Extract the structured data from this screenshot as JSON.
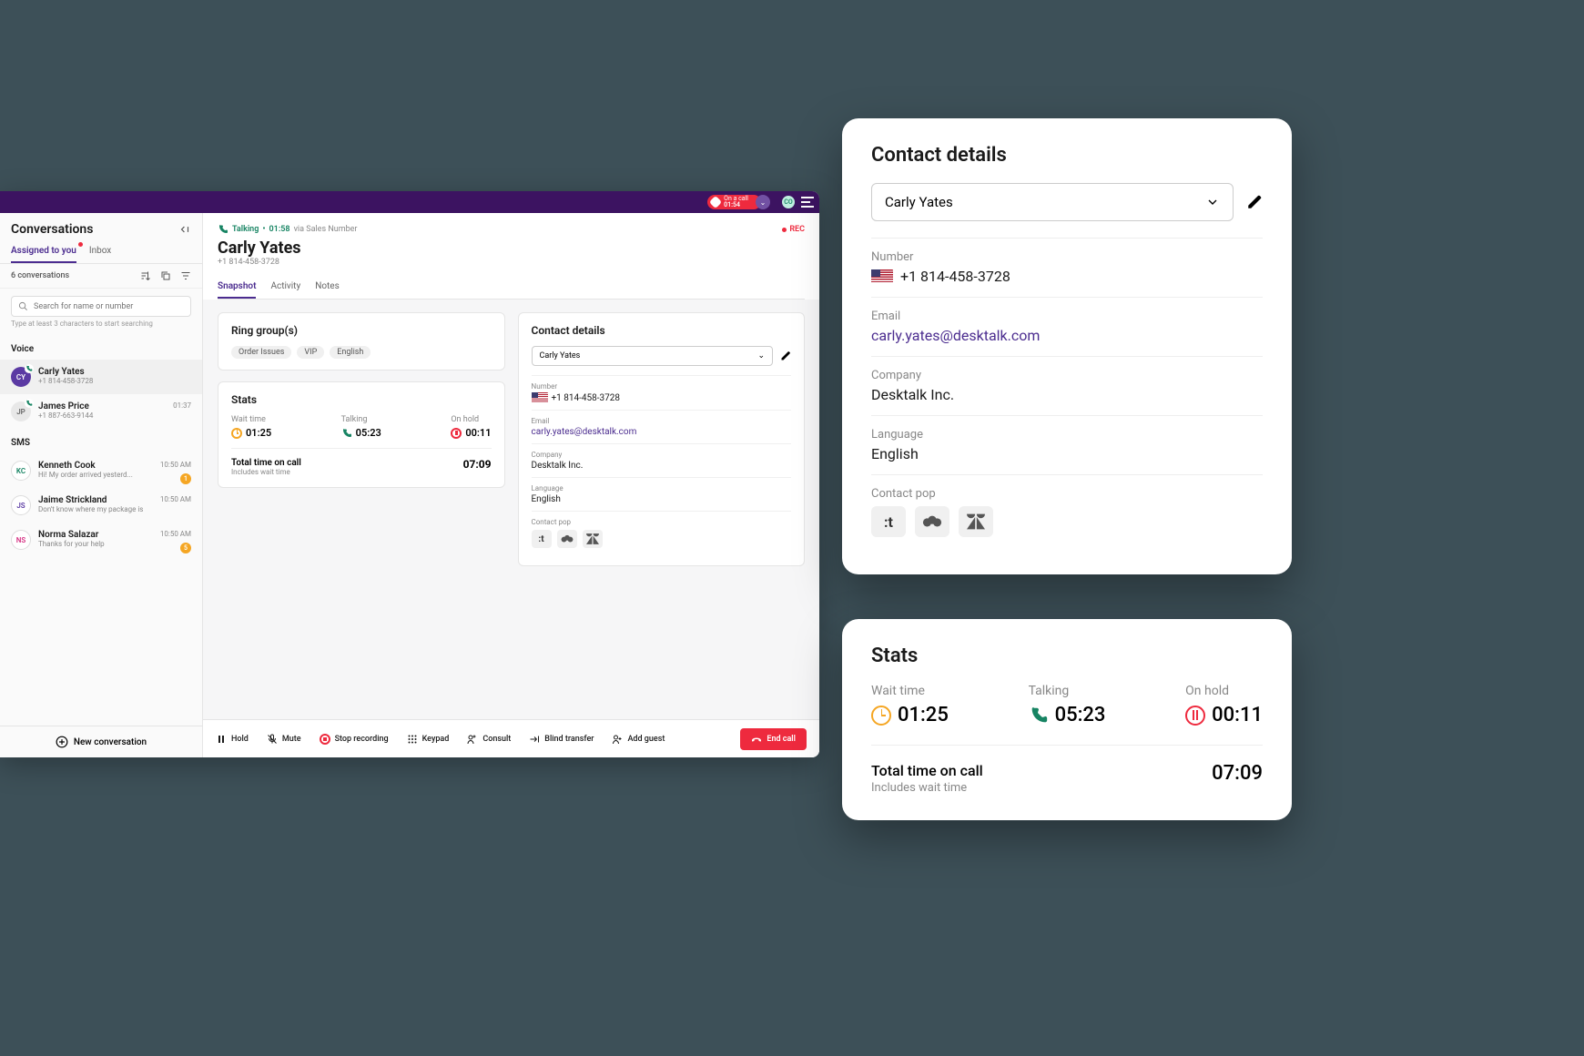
{
  "topbar": {
    "call_status": "On a call",
    "call_time": "01:54",
    "avatar": "CO"
  },
  "sidebar": {
    "title": "Conversations",
    "tabs": [
      "Assigned to you",
      "Inbox"
    ],
    "count": "6 conversations",
    "search_placeholder": "Search for name or number",
    "hint": "Type at least 3 characters to start searching",
    "voice_label": "Voice",
    "sms_label": "SMS",
    "voice": [
      {
        "initials": "CY",
        "name": "Carly Yates",
        "sub": "+1 814-458-3728",
        "time": "",
        "avbg": "#5b3aa3",
        "avfg": "#fff",
        "selected": true,
        "phone": true
      },
      {
        "initials": "JP",
        "name": "James Price",
        "sub": "+1 887-663-9144",
        "time": "01:37",
        "avbg": "#e8e8e8",
        "avfg": "#666",
        "selected": false,
        "phone": true
      }
    ],
    "sms": [
      {
        "initials": "KC",
        "name": "Kenneth Cook",
        "sub": "Hi! My order arrived yesterd...",
        "time": "10:50 AM",
        "avbg": "#fff",
        "avfg": "#178463",
        "badge": "1",
        "badgebg": "#f5a623"
      },
      {
        "initials": "JS",
        "name": "Jaime Strickland",
        "sub": "Don't know where my package is",
        "time": "10:50 AM",
        "avbg": "#fff",
        "avfg": "#5b3aa3"
      },
      {
        "initials": "NS",
        "name": "Norma Salazar",
        "sub": "Thanks for your help",
        "time": "10:50 AM",
        "avbg": "#fff",
        "avfg": "#d63384",
        "badge": "5",
        "badgebg": "#f5a623"
      }
    ],
    "new_conversation": "New conversation"
  },
  "main": {
    "status": "Talking",
    "status_time": "01:58",
    "via": "via Sales Number",
    "rec": "REC",
    "name": "Carly Yates",
    "phone": "+1 814-458-3728",
    "tabs": [
      "Snapshot",
      "Activity",
      "Notes"
    ],
    "ring_groups": {
      "title": "Ring group(s)",
      "chips": [
        "Order Issues",
        "VIP",
        "English"
      ]
    },
    "stats": {
      "title": "Stats",
      "wait": {
        "label": "Wait time",
        "value": "01:25"
      },
      "talking": {
        "label": "Talking",
        "value": "05:23"
      },
      "hold": {
        "label": "On hold",
        "value": "00:11"
      },
      "total": {
        "label": "Total time on call",
        "sub": "Includes wait time",
        "value": "07:09"
      }
    },
    "contact": {
      "title": "Contact details",
      "select": "Carly Yates",
      "number": {
        "label": "Number",
        "value": "+1 814-458-3728"
      },
      "email": {
        "label": "Email",
        "value": "carly.yates@desktalk.com"
      },
      "company": {
        "label": "Company",
        "value": "Desktalk Inc."
      },
      "language": {
        "label": "Language",
        "value": "English"
      },
      "pop_label": "Contact pop"
    }
  },
  "callbar": {
    "hold": "Hold",
    "mute": "Mute",
    "stop": "Stop recording",
    "keypad": "Keypad",
    "consult": "Consult",
    "blind": "Blind transfer",
    "guest": "Add guest",
    "end": "End call"
  },
  "ov_contact": {
    "title": "Contact details",
    "select": "Carly Yates",
    "number": {
      "label": "Number",
      "value": "+1 814-458-3728"
    },
    "email": {
      "label": "Email",
      "value": "carly.yates@desktalk.com"
    },
    "company": {
      "label": "Company",
      "value": "Desktalk Inc."
    },
    "language": {
      "label": "Language",
      "value": "English"
    },
    "pop_label": "Contact pop"
  },
  "ov_stats": {
    "title": "Stats",
    "wait": {
      "label": "Wait time",
      "value": "01:25"
    },
    "talking": {
      "label": "Talking",
      "value": "05:23"
    },
    "hold": {
      "label": "On hold",
      "value": "00:11"
    },
    "total": {
      "label": "Total time on call",
      "sub": "Includes wait time",
      "value": "07:09"
    }
  }
}
